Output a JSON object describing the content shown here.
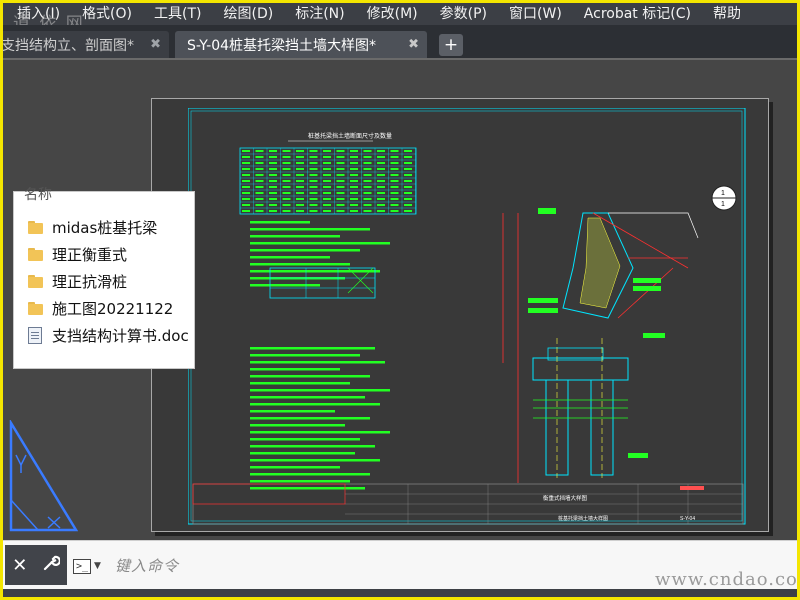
{
  "menu": {
    "items": [
      "插入(I)",
      "格式(O)",
      "工具(T)",
      "绘图(D)",
      "标注(N)",
      "修改(M)",
      "参数(P)",
      "窗口(W)",
      "Acrobat 标记(C)",
      "帮助"
    ]
  },
  "watermark_top": "道 依 网",
  "tabs": [
    {
      "label": "支挡结构立、剖面图*",
      "close": "✖"
    },
    {
      "label": "S-Y-04桩基托梁挡土墙大样图*",
      "close": "✖"
    }
  ],
  "add_tab": "+",
  "panel": {
    "title": "名称",
    "items": [
      {
        "label": "midas桩基托梁",
        "type": "folder"
      },
      {
        "label": "理正衡重式",
        "type": "folder"
      },
      {
        "label": "理正抗滑桩",
        "type": "folder"
      },
      {
        "label": "施工图20221122",
        "type": "folder"
      },
      {
        "label": "支挡结构计算书.doc",
        "type": "document"
      }
    ]
  },
  "drawing": {
    "table_title": "桩基托梁挡土墙断面尺寸及数量",
    "section_title": "衡重式挡墙大样图",
    "sheet_title": "桩基托梁挡土墙大样图",
    "drawing_no": "S-Y-04",
    "callout_top": "1",
    "callout_bottom": "1",
    "colors": {
      "line": "#22ff22",
      "cyan": "#00e5ff",
      "red": "#ff3030",
      "white": "#ffffff"
    }
  },
  "command": {
    "close_icon": "close-icon",
    "wrench_icon": "wrench-icon",
    "prompt_symbol": ">_",
    "placeholder": "键入命令"
  },
  "watermark_bottom": "www.cndao.com"
}
